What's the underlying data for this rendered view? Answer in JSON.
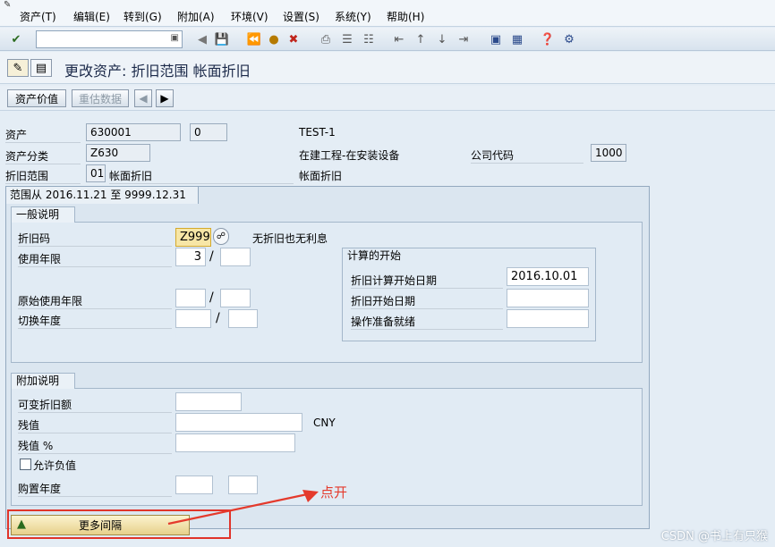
{
  "menu": [
    "资产(T)",
    "编辑(E)",
    "转到(G)",
    "附加(A)",
    "环境(V)",
    "设置(S)",
    "系统(Y)",
    "帮助(H)"
  ],
  "toolbar": {
    "command_value": ""
  },
  "page": {
    "title": "更改资产: 折旧范围 帐面折旧"
  },
  "appbar": {
    "btn_asset_value": "资产价值",
    "btn_revalue": "重估数据"
  },
  "header": {
    "asset_label": "资产",
    "asset_value": "630001",
    "subnumber": "0",
    "description": "TEST-1",
    "class_label": "资产分类",
    "class_value": "Z630",
    "class_desc": "在建工程-在安装设备",
    "company_label": "公司代码",
    "company_value": "1000",
    "area_label": "折旧范围",
    "area_value": "01",
    "area_name": "帐面折旧",
    "area_name2": "帐面折旧"
  },
  "tab": {
    "label": "范围从 2016.11.21 至 9999.12.31"
  },
  "general": {
    "title": "一般说明",
    "dep_key_label": "折旧码",
    "dep_key_value": "Z999",
    "dep_key_desc": "无折旧也无利息",
    "life_label": "使用年限",
    "life_years": "3",
    "life_periods": "",
    "orig_life_label": "原始使用年限",
    "orig_years": "",
    "orig_periods": "",
    "changeover_label": "切换年度",
    "chg_years": "",
    "chg_periods": "",
    "slash": "/"
  },
  "calc_start": {
    "title": "计算的开始",
    "dep_calc_label": "折旧计算开始日期",
    "dep_calc_value": "2016.10.01",
    "dep_start_label": "折旧开始日期",
    "dep_start_value": "",
    "op_ready_label": "操作准备就绪",
    "op_ready_value": ""
  },
  "additional": {
    "title": "附加说明",
    "var_label": "可变折旧额",
    "var_value": "",
    "scrap_label": "残值",
    "scrap_value": "",
    "currency": "CNY",
    "scrap_pct_label": "残值 %",
    "scrap_pct_value": "",
    "neg_label": "允许负值",
    "acq_year_label": "购置年度",
    "acq_year_value": "",
    "acq_period_value": ""
  },
  "more_button": {
    "label": "更多间隔"
  },
  "annotation": {
    "text": "点开"
  },
  "watermark": {
    "text": "CSDN @书上有只猴"
  },
  "colors": {
    "accent_red": "#e0342a",
    "title_blue": "#1c2a4a",
    "background": "#e4edf5"
  }
}
